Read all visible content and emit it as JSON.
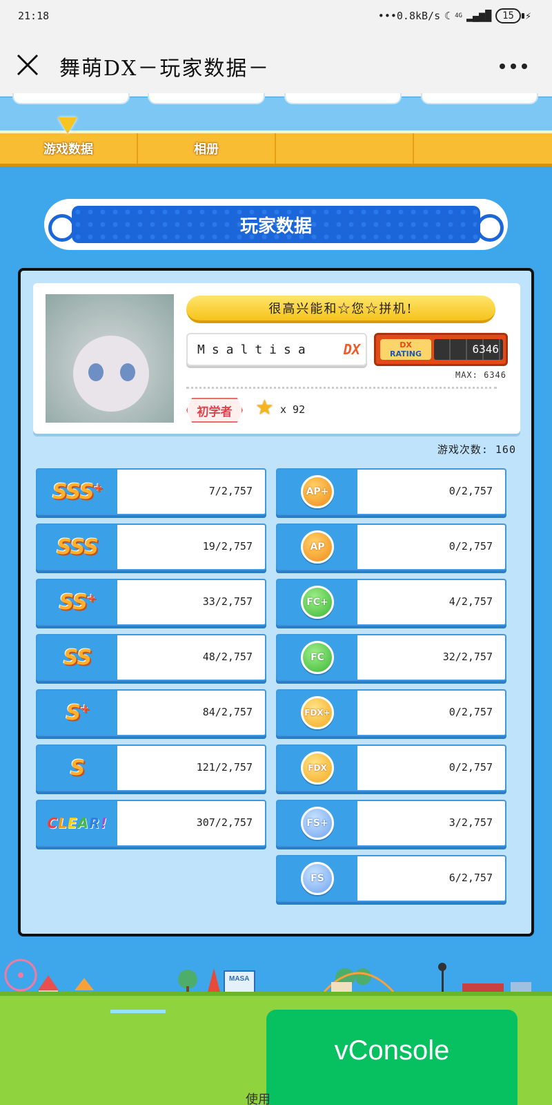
{
  "status": {
    "time": "21:18",
    "network": "•••0.8kB/s",
    "signal": "4G",
    "battery": "15"
  },
  "titlebar": {
    "title": "舞萌DX－玩家数据－"
  },
  "tabs": [
    {
      "label": "游戏数据"
    },
    {
      "label": "相册"
    },
    {
      "label": ""
    },
    {
      "label": ""
    }
  ],
  "banner": {
    "title": "玩家数据"
  },
  "profile": {
    "greeting": "很高兴能和☆您☆拼机!",
    "name": "Msaltisa",
    "name_badge": "DX",
    "rating_label_top": "DX",
    "rating_label_bottom": "RATING",
    "rating": "6346",
    "max": "MAX: 6346",
    "class": "初学者",
    "stars": "x 92"
  },
  "plays": "游戏次数: 160",
  "left_stats": [
    {
      "rank": "SSS",
      "plus": "+",
      "count": "7/2,757"
    },
    {
      "rank": "SSS",
      "plus": "",
      "count": "19/2,757"
    },
    {
      "rank": "SS",
      "plus": "+",
      "count": "33/2,757"
    },
    {
      "rank": "SS",
      "plus": "",
      "count": "48/2,757"
    },
    {
      "rank": "S",
      "plus": "+",
      "count": "84/2,757"
    },
    {
      "rank": "S",
      "plus": "",
      "count": "121/2,757"
    },
    {
      "rank": "CLEAR!",
      "plus": "",
      "count": "307/2,757"
    }
  ],
  "right_stats": [
    {
      "badge": "AP+",
      "kind": "ap",
      "count": "0/2,757"
    },
    {
      "badge": "AP",
      "kind": "ap",
      "count": "0/2,757"
    },
    {
      "badge": "FC+",
      "kind": "fc",
      "count": "4/2,757"
    },
    {
      "badge": "FC",
      "kind": "fc",
      "count": "32/2,757"
    },
    {
      "badge": "FDX+",
      "kind": "fdx",
      "count": "0/2,757"
    },
    {
      "badge": "FDX",
      "kind": "fdx",
      "count": "0/2,757"
    },
    {
      "badge": "FS+",
      "kind": "fs",
      "count": "3/2,757"
    },
    {
      "badge": "FS",
      "kind": "fs",
      "count": "6/2,757"
    }
  ],
  "scene": {
    "sign": "MASA"
  },
  "vconsole": {
    "label": "vConsole"
  },
  "footer": {
    "text": "使用"
  }
}
